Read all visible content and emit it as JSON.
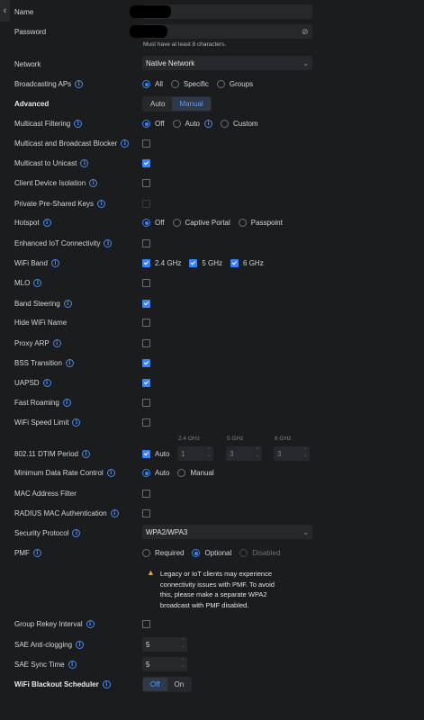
{
  "rows": {
    "name": {
      "label": "Name"
    },
    "password": {
      "label": "Password",
      "hint": "Must have at least 8 characters."
    },
    "network": {
      "label": "Network",
      "value": "Native Network"
    },
    "broadcasting": {
      "label": "Broadcasting APs",
      "options": [
        "All",
        "Specific",
        "Groups"
      ],
      "selected": "All"
    },
    "advanced": {
      "label": "Advanced",
      "options": [
        "Auto",
        "Manual"
      ],
      "selected": "Manual"
    },
    "multicast_filtering": {
      "label": "Multicast Filtering",
      "options": [
        "Off",
        "Auto",
        "Custom"
      ],
      "selected": "Off"
    },
    "mc_bc_blocker": {
      "label": "Multicast and Broadcast Blocker",
      "checked": false
    },
    "mc_to_uc": {
      "label": "Multicast to Unicast",
      "checked": true
    },
    "client_isolation": {
      "label": "Client Device Isolation",
      "checked": false
    },
    "ppsk": {
      "label": "Private Pre-Shared Keys",
      "checked": false,
      "disabled": true
    },
    "hotspot": {
      "label": "Hotspot",
      "options": [
        "Off",
        "Captive Portal",
        "Passpoint"
      ],
      "selected": "Off"
    },
    "iot": {
      "label": "Enhanced IoT Connectivity",
      "checked": false
    },
    "wifi_band": {
      "label": "WiFi Band",
      "options": [
        "2.4 GHz",
        "5 GHz",
        "6 GHz"
      ]
    },
    "mlo": {
      "label": "MLO",
      "checked": false
    },
    "band_steering": {
      "label": "Band Steering",
      "checked": true
    },
    "hide_name": {
      "label": "Hide WiFi Name",
      "checked": false
    },
    "proxy_arp": {
      "label": "Proxy ARP",
      "checked": false
    },
    "bss_transition": {
      "label": "BSS Transition",
      "checked": true
    },
    "uapsd": {
      "label": "UAPSD",
      "checked": true
    },
    "fast_roaming": {
      "label": "Fast Roaming",
      "checked": false
    },
    "speed_limit": {
      "label": "WiFi Speed Limit",
      "checked": false
    },
    "dtim": {
      "label": "802.11 DTIM Period",
      "auto_label": "Auto",
      "cols": [
        "2.4 GHz",
        "5 GHz",
        "6 GHz"
      ],
      "values": [
        "1",
        "3",
        "3"
      ]
    },
    "min_rate": {
      "label": "Minimum Data Rate Control",
      "options": [
        "Auto",
        "Manual"
      ],
      "selected": "Auto"
    },
    "mac_filter": {
      "label": "MAC Address Filter",
      "checked": false
    },
    "radius_mac": {
      "label": "RADIUS MAC Authentication",
      "checked": false
    },
    "security": {
      "label": "Security Protocol",
      "value": "WPA2/WPA3"
    },
    "pmf": {
      "label": "PMF",
      "options": [
        "Required",
        "Optional",
        "Disabled"
      ],
      "selected": "Optional",
      "warning": "Legacy or IoT clients may experience connectivity issues with PMF. To avoid this, please make a separate WPA2 broadcast with PMF disabled."
    },
    "rekey": {
      "label": "Group Rekey Interval",
      "checked": false
    },
    "sae_anti": {
      "label": "SAE Anti-clogging",
      "value": "5"
    },
    "sae_sync": {
      "label": "SAE Sync Time",
      "value": "5"
    },
    "blackout": {
      "label": "WiFi Blackout Scheduler",
      "options": [
        "Off",
        "On"
      ],
      "selected": "Off"
    }
  },
  "icons": {
    "back": "chevron-left-icon",
    "info": "info-icon",
    "eye": "eye-off-icon",
    "warning": "warning-icon"
  },
  "colors": {
    "accent": "#3b82f6",
    "background": "#1b1c1e",
    "warning": "#e2a33b"
  }
}
